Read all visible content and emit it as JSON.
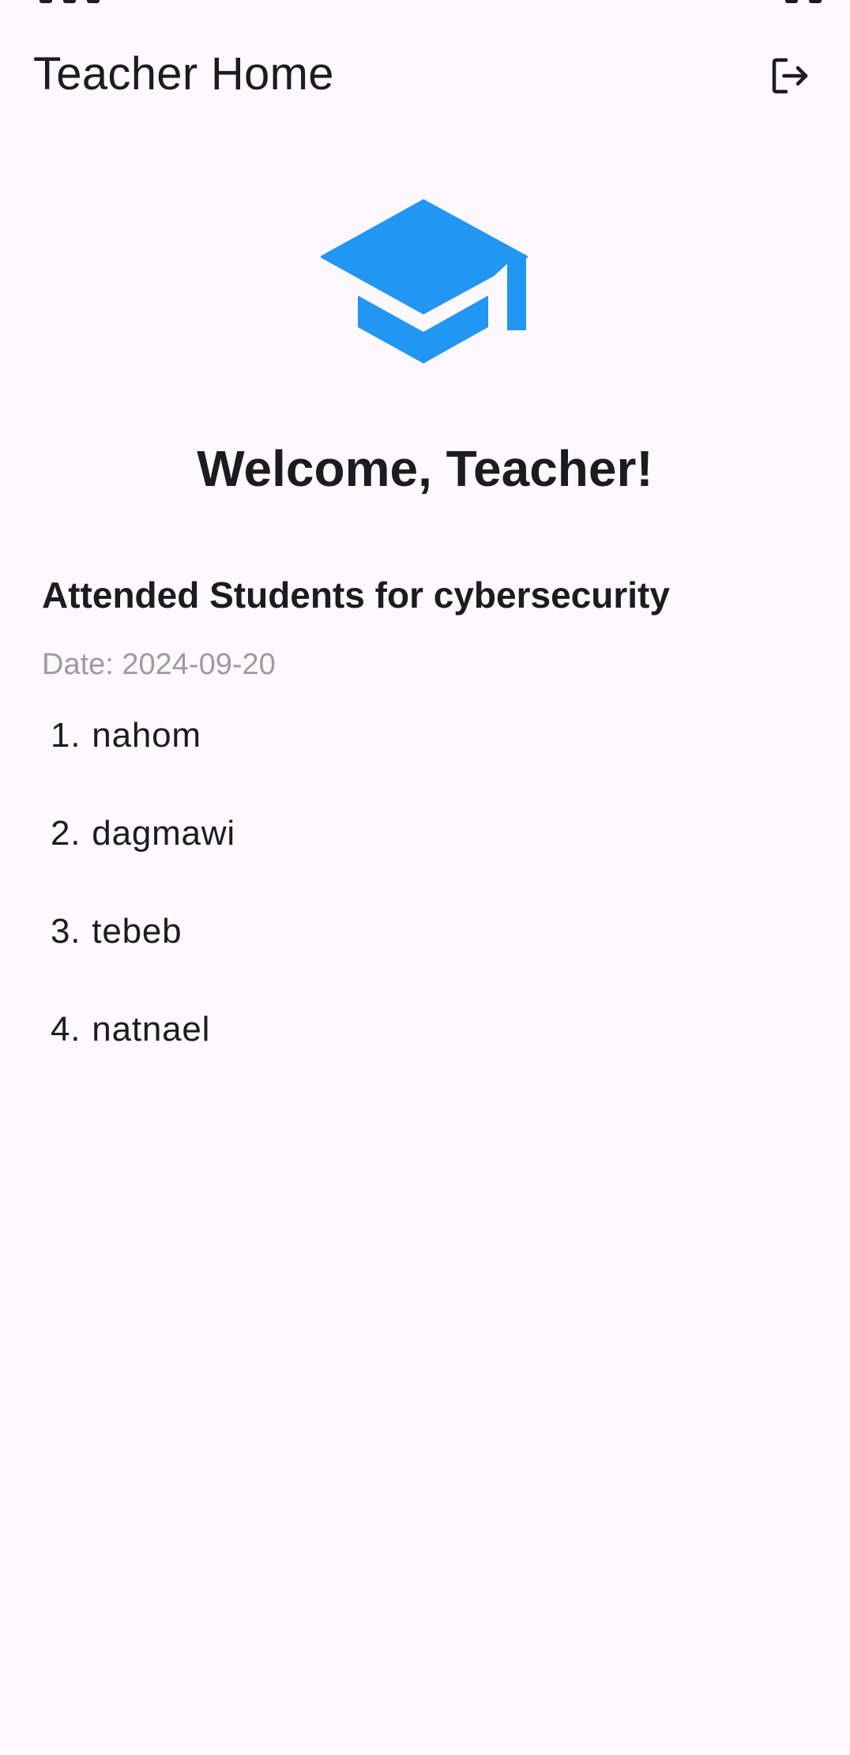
{
  "app_bar": {
    "title": "Teacher Home",
    "logout_icon": "logout-icon"
  },
  "logo": {
    "icon": "graduation-cap-icon",
    "color": "#2196f3"
  },
  "welcome": {
    "text": "Welcome, Teacher!"
  },
  "attendance": {
    "title": "Attended Students for cybersecurity",
    "date": "Date: 2024-09-20",
    "students": [
      {
        "number": "1.",
        "name": "nahom"
      },
      {
        "number": "2.",
        "name": "dagmawi"
      },
      {
        "number": "3.",
        "name": "tebeb"
      },
      {
        "number": "4.",
        "name": "natnael"
      }
    ]
  },
  "colors": {
    "background": "#fdf8fd",
    "text": "#1d1b20",
    "muted": "#9e9a9f",
    "accent": "#2196f3"
  }
}
